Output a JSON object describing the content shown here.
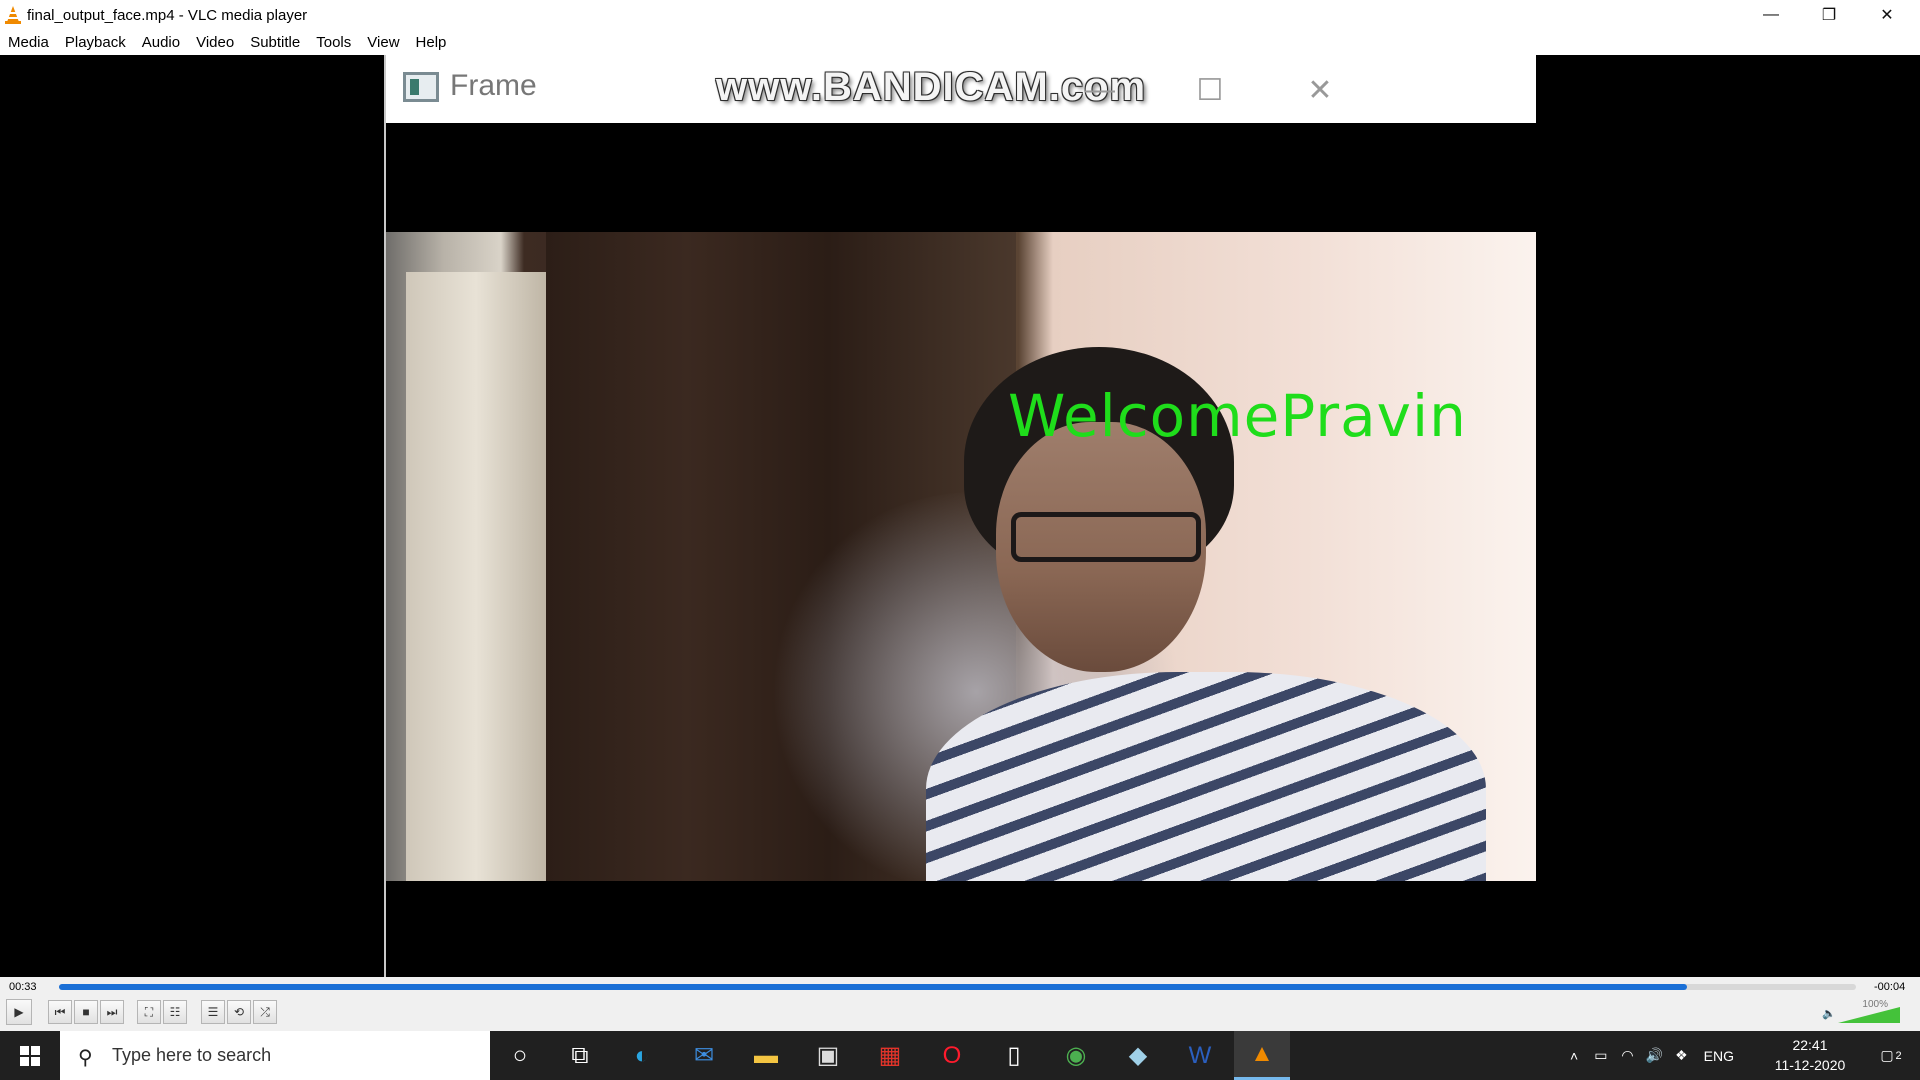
{
  "window": {
    "title": "final_output_face.mp4 - VLC media player",
    "minimize": "—",
    "restore": "❐",
    "close": "✕"
  },
  "menu": [
    "Media",
    "Playback",
    "Audio",
    "Video",
    "Subtitle",
    "Tools",
    "View",
    "Help"
  ],
  "frame_window": {
    "title": "Frame",
    "watermark": "www.BANDICAM.com",
    "minimize": "—",
    "maximize": "☐",
    "close": "✕"
  },
  "video": {
    "overlay_text": "WelcomePravin",
    "overlay_color": "#1fdd1b"
  },
  "controls": {
    "elapsed": "00:33",
    "remaining": "-00:04",
    "progress": 0.906,
    "volume_label": "100%",
    "buttons": [
      "play-icon",
      "prev-icon",
      "stop-icon",
      "next-icon",
      "fullscreen-icon",
      "extended-settings-icon",
      "playlist-icon",
      "loop-icon",
      "shuffle-icon"
    ]
  },
  "taskbar": {
    "search_placeholder": "Type here to search",
    "apps": [
      "cortana-icon",
      "task-view-icon",
      "edge-icon",
      "mail-icon",
      "file-explorer-icon",
      "store-icon",
      "gift-icon",
      "opera-icon",
      "notepad-icon",
      "chrome-icon",
      "notes-icon",
      "word-icon",
      "vlc-icon"
    ],
    "tray_lang": "ENG",
    "time": "22:41",
    "date": "11-12-2020",
    "notification_count": "2"
  }
}
